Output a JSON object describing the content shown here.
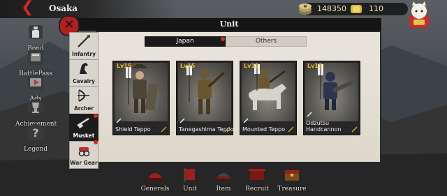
{
  "topbar": {
    "city": "Osaka"
  },
  "resources": {
    "coins": "148350",
    "gold": "110"
  },
  "left_menu": [
    {
      "label": "Bond",
      "icon": "sake-bottle-icon"
    },
    {
      "label": "BattlePass",
      "icon": "battlepass-icon"
    },
    {
      "label": "Ads",
      "icon": "video-ad-icon"
    },
    {
      "label": "Achievement",
      "icon": "trophy-icon"
    },
    {
      "label": "Legend",
      "icon": "question-icon"
    }
  ],
  "panel": {
    "title": "Unit",
    "tabs": [
      {
        "label": "Japan",
        "active": true
      },
      {
        "label": "Others",
        "active": false
      }
    ]
  },
  "categories": [
    {
      "label": "Infantry",
      "icon": "spear-icon",
      "active": false,
      "badge": false
    },
    {
      "label": "Cavalry",
      "icon": "horse-icon",
      "active": false,
      "badge": false
    },
    {
      "label": "Archer",
      "icon": "bow-icon",
      "active": false,
      "badge": false
    },
    {
      "label": "Musket",
      "icon": "musket-icon",
      "active": true,
      "badge": true
    },
    {
      "label": "War Gear",
      "icon": "cannon-icon",
      "active": false,
      "badge": true
    }
  ],
  "units": [
    {
      "level": "Lv15",
      "name": "Shield Teppo"
    },
    {
      "level": "Lv15",
      "name": "Tanegashima Teppo"
    },
    {
      "level": "Lv15",
      "name": "Mounted Teppo"
    },
    {
      "level": "Lv15",
      "name": "Odzutsu Handcannon"
    }
  ],
  "bottom_nav": [
    {
      "label": "Generals"
    },
    {
      "label": "Unit"
    },
    {
      "label": "Item"
    },
    {
      "label": "Recruit"
    },
    {
      "label": "Treasure"
    }
  ],
  "colors": {
    "accent_red": "#d12a2a",
    "level_gold": "#e7bd2e",
    "panel_bg": "#e7e3da"
  }
}
